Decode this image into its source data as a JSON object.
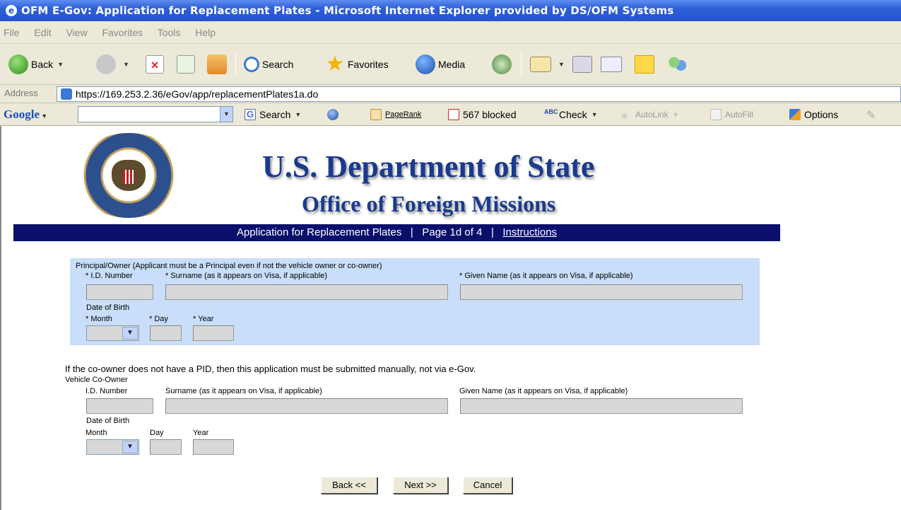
{
  "window": {
    "title": "OFM E-Gov: Application for Replacement Plates - Microsoft Internet Explorer provided by DS/OFM Systems"
  },
  "menu": [
    "File",
    "Edit",
    "View",
    "Favorites",
    "Tools",
    "Help"
  ],
  "toolbar": {
    "back": "Back",
    "search": "Search",
    "favorites": "Favorites",
    "media": "Media"
  },
  "address": {
    "label": "Address",
    "url": "https://169.253.2.36/eGov/app/replacementPlates1a.do"
  },
  "google": {
    "logo": "Google",
    "search": "Search",
    "pagerank": "PageRank",
    "blocked": "567 blocked",
    "check": "Check",
    "autolink": "AutoLink",
    "autofill": "AutoFill",
    "options": "Options"
  },
  "header": {
    "title": "U.S. Department of State",
    "subtitle": "Office of Foreign Missions",
    "nav_app": "Application for Replacement Plates",
    "nav_sep1": "|",
    "nav_page": "Page 1d of 4",
    "nav_sep2": "|",
    "nav_instructions": "Instructions"
  },
  "principal": {
    "heading": "Principal/Owner (Applicant must be a Principal even if not the vehicle owner or co-owner)",
    "id_label": "* I.D. Number",
    "surname_label": "* Surname (as it appears on Visa, if applicable)",
    "given_label": "* Given Name (as it appears on Visa, if applicable)",
    "dob_label": "Date of Birth",
    "month_label": "* Month",
    "day_label": "* Day",
    "year_label": "* Year"
  },
  "coowner": {
    "notice": "If the co-owner does not have a PID, then this application must be submitted manually, not via e-Gov.",
    "heading": "Vehicle Co-Owner",
    "id_label": "I.D. Number",
    "surname_label": "Surname (as it appears on Visa, if applicable)",
    "given_label": "Given Name (as it appears on Visa, if applicable)",
    "dob_label": "Date of Birth",
    "month_label": "Month",
    "day_label": "Day",
    "year_label": "Year"
  },
  "buttons": {
    "back": "Back <<",
    "next": "Next >>",
    "cancel": "Cancel"
  }
}
